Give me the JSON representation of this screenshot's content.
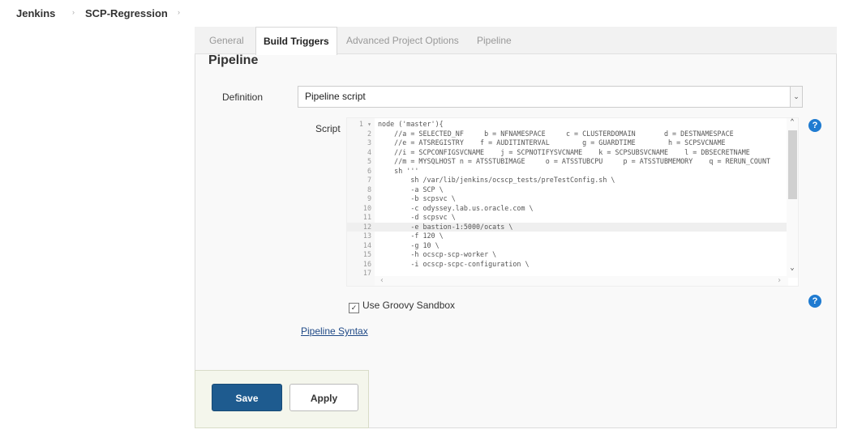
{
  "breadcrumb": {
    "items": [
      "Jenkins",
      "SCP-Regression"
    ],
    "separator": "›"
  },
  "tabs": [
    {
      "label": "General",
      "active": false
    },
    {
      "label": "Build Triggers",
      "active": true
    },
    {
      "label": "Advanced Project Options",
      "active": false
    },
    {
      "label": "Pipeline",
      "active": false
    }
  ],
  "section_title": "Pipeline",
  "definition": {
    "label": "Definition",
    "value": "Pipeline script"
  },
  "script": {
    "label": "Script",
    "lines": [
      {
        "num": "1",
        "text": "node ('master'){",
        "fold": true
      },
      {
        "num": "2",
        "text": "    //a = SELECTED_NF     b = NFNAMESPACE     c = CLUSTERDOMAIN       d = DESTNAMESPACE"
      },
      {
        "num": "3",
        "text": "    //e = ATSREGISTRY    f = AUDITINTERVAL        g = GUARDTIME        h = SCPSVCNAME"
      },
      {
        "num": "4",
        "text": "    //i = SCPCONFIGSVCNAME    j = SCPNOTIFYSVCNAME    k = SCPSUBSVCNAME    l = DBSECRETNAME"
      },
      {
        "num": "5",
        "text": "    //m = MYSQLHOST n = ATSSTUBIMAGE     o = ATSSTUBCPU     p = ATSSTUBMEMORY    q = RERUN_COUNT"
      },
      {
        "num": "6",
        "text": "    sh '''"
      },
      {
        "num": "7",
        "text": "        sh /var/lib/jenkins/ocscp_tests/preTestConfig.sh \\"
      },
      {
        "num": "8",
        "text": "        -a SCP \\"
      },
      {
        "num": "9",
        "text": "        -b scpsvc \\"
      },
      {
        "num": "10",
        "text": "        -c odyssey.lab.us.oracle.com \\"
      },
      {
        "num": "11",
        "text": "        -d scpsvc \\"
      },
      {
        "num": "12",
        "text": "        -e bastion-1:5000/ocats \\",
        "highlight": true
      },
      {
        "num": "13",
        "text": "        -f 120 \\"
      },
      {
        "num": "14",
        "text": "        -g 10 \\"
      },
      {
        "num": "15",
        "text": "        -h ocscp-scp-worker \\"
      },
      {
        "num": "16",
        "text": "        -i ocscp-scpc-configuration \\"
      },
      {
        "num": "17",
        "text": ""
      }
    ]
  },
  "sandbox": {
    "label": "Use Groovy Sandbox",
    "checked": true
  },
  "pipeline_syntax_link": "Pipeline Syntax",
  "buttons": {
    "save": "Save",
    "apply": "Apply"
  },
  "colors": {
    "save_bg": "#1e5b8f",
    "help_icon": "#1f7bd1",
    "link": "#204a87"
  }
}
